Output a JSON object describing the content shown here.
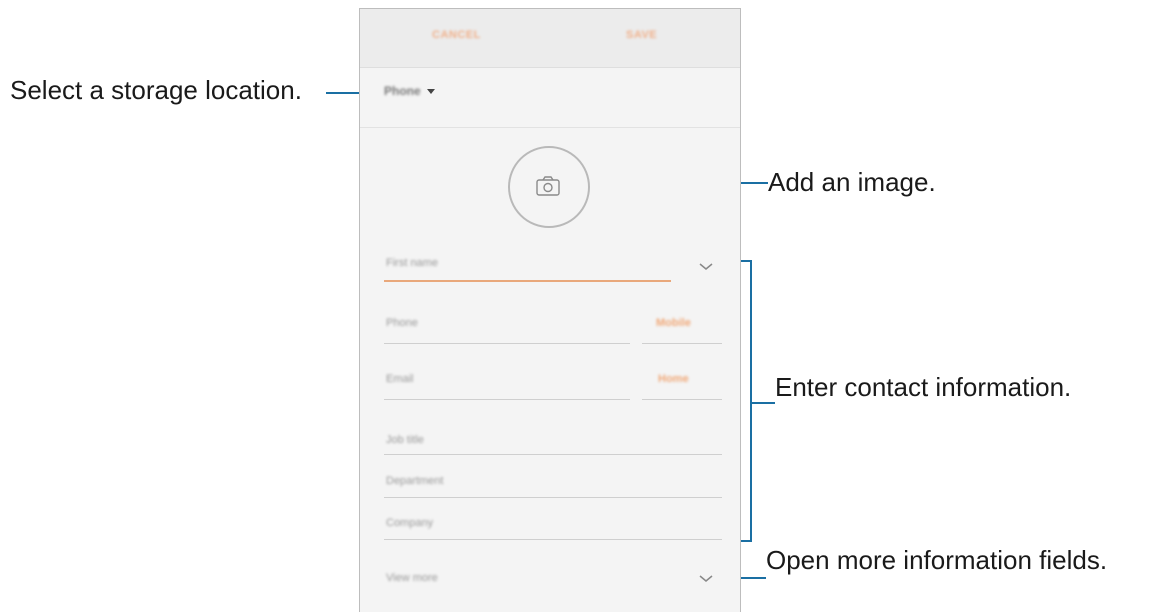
{
  "callouts": {
    "storage": "Select a storage location.",
    "image": "Add an image.",
    "contact": "Enter contact information.",
    "more": "Open more information fields."
  },
  "phone": {
    "topbar": {
      "cancel_label": "CANCEL",
      "save_label": "SAVE"
    },
    "storage_location": "Phone",
    "fields": {
      "name_placeholder": "First name",
      "phone_placeholder": "Phone",
      "phone_type": "Mobile",
      "email_placeholder": "Email",
      "email_type": "Home",
      "job_title_placeholder": "Job title",
      "department_placeholder": "Department",
      "company_placeholder": "Company",
      "more_fields_label": "View more"
    }
  },
  "icons": {
    "photo": "camera-icon",
    "storage_dropdown": "caret-down-icon",
    "name_expand": "chevron-down-icon",
    "more_expand": "chevron-down-icon"
  },
  "colors": {
    "accent": "#e9a87b",
    "callout_line": "#1a6fa3"
  }
}
